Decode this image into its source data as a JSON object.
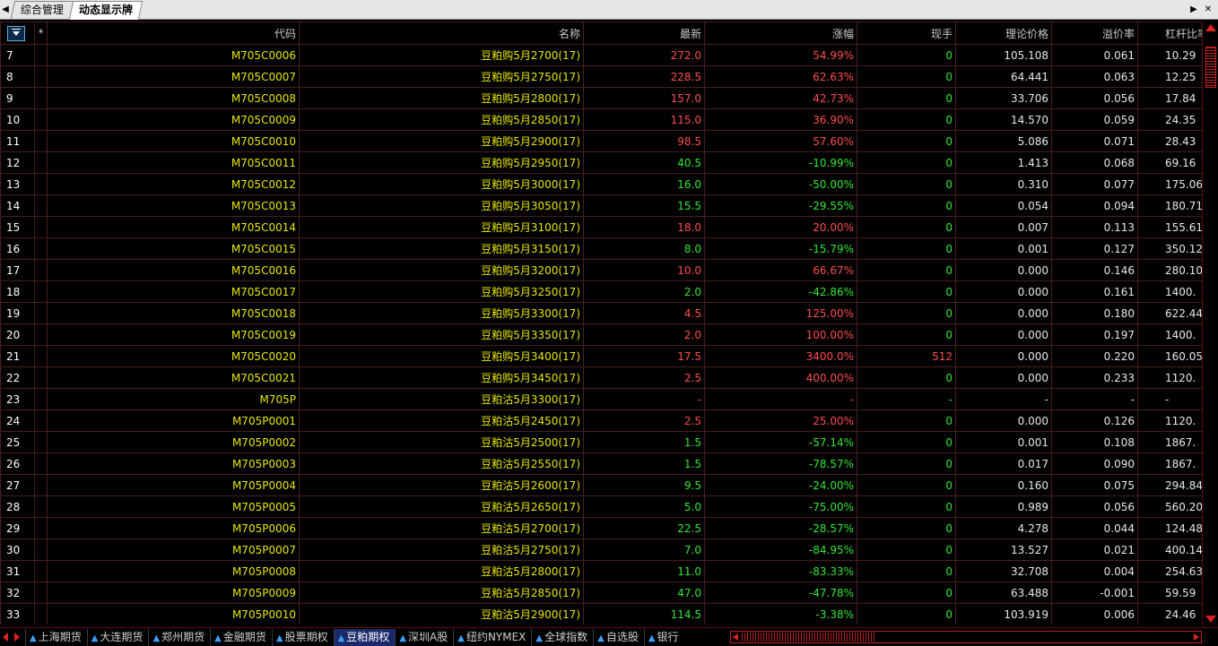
{
  "tabbar": {
    "tabs": [
      {
        "label": "综合管理",
        "active": false
      },
      {
        "label": "动态显示牌",
        "active": true
      }
    ]
  },
  "table": {
    "headers": {
      "star": "*",
      "code": "代码",
      "name": "名称",
      "last": "最新",
      "change": "涨幅",
      "volume": "现手",
      "theo": "理论价格",
      "premium": "溢价率",
      "leverage": "杠杆比率"
    },
    "rows": [
      {
        "idx": "7",
        "code": "M705C0006",
        "name": "豆粕购5月2700(17)",
        "last": "272.0",
        "change": "54.99%",
        "volume": "0",
        "theo": "105.108",
        "premium": "0.061",
        "leverage": "10.29",
        "dir": "up"
      },
      {
        "idx": "8",
        "code": "M705C0007",
        "name": "豆粕购5月2750(17)",
        "last": "228.5",
        "change": "62.63%",
        "volume": "0",
        "theo": "64.441",
        "premium": "0.063",
        "leverage": "12.25",
        "dir": "up"
      },
      {
        "idx": "9",
        "code": "M705C0008",
        "name": "豆粕购5月2800(17)",
        "last": "157.0",
        "change": "42.73%",
        "volume": "0",
        "theo": "33.706",
        "premium": "0.056",
        "leverage": "17.84",
        "dir": "up"
      },
      {
        "idx": "10",
        "code": "M705C0009",
        "name": "豆粕购5月2850(17)",
        "last": "115.0",
        "change": "36.90%",
        "volume": "0",
        "theo": "14.570",
        "premium": "0.059",
        "leverage": "24.35",
        "dir": "up"
      },
      {
        "idx": "11",
        "code": "M705C0010",
        "name": "豆粕购5月2900(17)",
        "last": "98.5",
        "change": "57.60%",
        "volume": "0",
        "theo": "5.086",
        "premium": "0.071",
        "leverage": "28.43",
        "dir": "up"
      },
      {
        "idx": "12",
        "code": "M705C0011",
        "name": "豆粕购5月2950(17)",
        "last": "40.5",
        "change": "-10.99%",
        "volume": "0",
        "theo": "1.413",
        "premium": "0.068",
        "leverage": "69.16",
        "dir": "down"
      },
      {
        "idx": "13",
        "code": "M705C0012",
        "name": "豆粕购5月3000(17)",
        "last": "16.0",
        "change": "-50.00%",
        "volume": "0",
        "theo": "0.310",
        "premium": "0.077",
        "leverage": "175.06",
        "dir": "down"
      },
      {
        "idx": "14",
        "code": "M705C0013",
        "name": "豆粕购5月3050(17)",
        "last": "15.5",
        "change": "-29.55%",
        "volume": "0",
        "theo": "0.054",
        "premium": "0.094",
        "leverage": "180.71",
        "dir": "down"
      },
      {
        "idx": "15",
        "code": "M705C0014",
        "name": "豆粕购5月3100(17)",
        "last": "18.0",
        "change": "20.00%",
        "volume": "0",
        "theo": "0.007",
        "premium": "0.113",
        "leverage": "155.61",
        "dir": "up"
      },
      {
        "idx": "16",
        "code": "M705C0015",
        "name": "豆粕购5月3150(17)",
        "last": "8.0",
        "change": "-15.79%",
        "volume": "0",
        "theo": "0.001",
        "premium": "0.127",
        "leverage": "350.12",
        "dir": "down"
      },
      {
        "idx": "17",
        "code": "M705C0016",
        "name": "豆粕购5月3200(17)",
        "last": "10.0",
        "change": "66.67%",
        "volume": "0",
        "theo": "0.000",
        "premium": "0.146",
        "leverage": "280.10",
        "dir": "up"
      },
      {
        "idx": "18",
        "code": "M705C0017",
        "name": "豆粕购5月3250(17)",
        "last": "2.0",
        "change": "-42.86%",
        "volume": "0",
        "theo": "0.000",
        "premium": "0.161",
        "leverage": "1400.",
        "dir": "down"
      },
      {
        "idx": "19",
        "code": "M705C0018",
        "name": "豆粕购5月3300(17)",
        "last": "4.5",
        "change": "125.00%",
        "volume": "0",
        "theo": "0.000",
        "premium": "0.180",
        "leverage": "622.44",
        "dir": "up"
      },
      {
        "idx": "20",
        "code": "M705C0019",
        "name": "豆粕购5月3350(17)",
        "last": "2.0",
        "change": "100.00%",
        "volume": "0",
        "theo": "0.000",
        "premium": "0.197",
        "leverage": "1400.",
        "dir": "up"
      },
      {
        "idx": "21",
        "code": "M705C0020",
        "name": "豆粕购5月3400(17)",
        "last": "17.5",
        "change": "3400.0%",
        "volume": "512",
        "theo": "0.000",
        "premium": "0.220",
        "leverage": "160.05",
        "dir": "up"
      },
      {
        "idx": "22",
        "code": "M705C0021",
        "name": "豆粕购5月3450(17)",
        "last": "2.5",
        "change": "400.00%",
        "volume": "0",
        "theo": "0.000",
        "premium": "0.233",
        "leverage": "1120.",
        "dir": "up"
      },
      {
        "idx": "23",
        "code": "M705P",
        "name": "豆粕沽5月3300(17)",
        "last": "-",
        "change": "-",
        "volume": "-",
        "theo": "-",
        "premium": "-",
        "leverage": "-",
        "dir": "none"
      },
      {
        "idx": "24",
        "code": "M705P0001",
        "name": "豆粕沽5月2450(17)",
        "last": "2.5",
        "change": "25.00%",
        "volume": "0",
        "theo": "0.000",
        "premium": "0.126",
        "leverage": "1120.",
        "dir": "up"
      },
      {
        "idx": "25",
        "code": "M705P0002",
        "name": "豆粕沽5月2500(17)",
        "last": "1.5",
        "change": "-57.14%",
        "volume": "0",
        "theo": "0.001",
        "premium": "0.108",
        "leverage": "1867.",
        "dir": "down"
      },
      {
        "idx": "26",
        "code": "M705P0003",
        "name": "豆粕沽5月2550(17)",
        "last": "1.5",
        "change": "-78.57%",
        "volume": "0",
        "theo": "0.017",
        "premium": "0.090",
        "leverage": "1867.",
        "dir": "down"
      },
      {
        "idx": "27",
        "code": "M705P0004",
        "name": "豆粕沽5月2600(17)",
        "last": "9.5",
        "change": "-24.00%",
        "volume": "0",
        "theo": "0.160",
        "premium": "0.075",
        "leverage": "294.84",
        "dir": "down"
      },
      {
        "idx": "28",
        "code": "M705P0005",
        "name": "豆粕沽5月2650(17)",
        "last": "5.0",
        "change": "-75.00%",
        "volume": "0",
        "theo": "0.989",
        "premium": "0.056",
        "leverage": "560.20",
        "dir": "down"
      },
      {
        "idx": "29",
        "code": "M705P0006",
        "name": "豆粕沽5月2700(17)",
        "last": "22.5",
        "change": "-28.57%",
        "volume": "0",
        "theo": "4.278",
        "premium": "0.044",
        "leverage": "124.48",
        "dir": "down"
      },
      {
        "idx": "30",
        "code": "M705P0007",
        "name": "豆粕沽5月2750(17)",
        "last": "7.0",
        "change": "-84.95%",
        "volume": "0",
        "theo": "13.527",
        "premium": "0.021",
        "leverage": "400.14",
        "dir": "down"
      },
      {
        "idx": "31",
        "code": "M705P0008",
        "name": "豆粕沽5月2800(17)",
        "last": "11.0",
        "change": "-83.33%",
        "volume": "0",
        "theo": "32.708",
        "premium": "0.004",
        "leverage": "254.63",
        "dir": "down"
      },
      {
        "idx": "32",
        "code": "M705P0009",
        "name": "豆粕沽5月2850(17)",
        "last": "47.0",
        "change": "-47.78%",
        "volume": "0",
        "theo": "63.488",
        "premium": "-0.001",
        "leverage": "59.59",
        "dir": "down"
      },
      {
        "idx": "33",
        "code": "M705P0010",
        "name": "豆粕沽5月2900(17)",
        "last": "114.5",
        "change": "-3.38%",
        "volume": "0",
        "theo": "103.919",
        "premium": "0.006",
        "leverage": "24.46",
        "dir": "down"
      }
    ]
  },
  "bottombar": {
    "tabs": [
      {
        "label": "上海期货",
        "active": false
      },
      {
        "label": "大连期货",
        "active": false
      },
      {
        "label": "郑州期货",
        "active": false
      },
      {
        "label": "金融期货",
        "active": false
      },
      {
        "label": "股票期权",
        "active": false
      },
      {
        "label": "豆粕期权",
        "active": true
      },
      {
        "label": "深圳A股",
        "active": false
      },
      {
        "label": "纽约NYMEX",
        "active": false
      },
      {
        "label": "全球指数",
        "active": false
      },
      {
        "label": "自选股",
        "active": false
      },
      {
        "label": "银行",
        "active": false
      }
    ]
  },
  "colors": {
    "up": "#ff4d4d",
    "down": "#33e633",
    "code": "#e6e600",
    "header": "#c8c8c8",
    "index": "#39d6e6",
    "accent": "#e02020"
  }
}
